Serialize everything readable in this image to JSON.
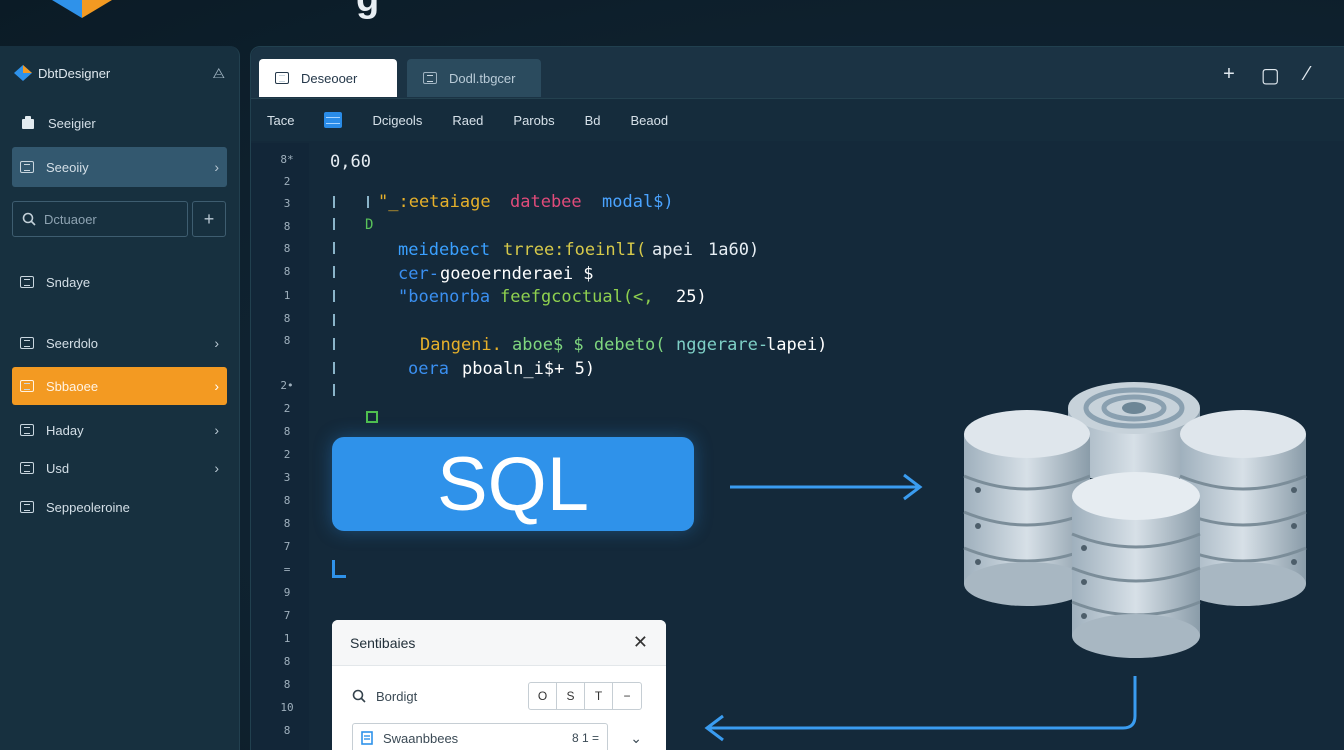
{
  "app": {
    "name": "DbtDesigner"
  },
  "sidebar": {
    "header_label": "DbtDesigner",
    "items": [
      {
        "label": "Seeigier"
      },
      {
        "label": "Seeoiiy"
      },
      {
        "label": "Sndaye"
      },
      {
        "label": "Seerdolo"
      },
      {
        "label": "Sbbaoee"
      },
      {
        "label": "Haday"
      },
      {
        "label": "Usd"
      },
      {
        "label": "Seppeoleroine"
      }
    ],
    "search_placeholder": "Dctuaoer"
  },
  "tabs": [
    {
      "label": "Deseooer"
    },
    {
      "label": "Dodl.tbgcer"
    }
  ],
  "toolbar": {
    "items": [
      "Tace",
      "Dcigeols",
      "Raed",
      "Parobs",
      "Bd",
      "Beaod"
    ]
  },
  "gutter": {
    "line_labels": [
      "8*",
      "2",
      "3",
      "8",
      "8",
      "8",
      "1",
      "8",
      "8",
      "2•",
      "2",
      "8",
      "2",
      "3",
      "8",
      "8",
      "7",
      "=",
      "9",
      "7",
      "1",
      "8",
      "8",
      "10",
      "8"
    ]
  },
  "code": {
    "header": "0,60",
    "lines": [
      {
        "text": "\"_:eetaiage",
        "color": "#e6b02a"
      },
      {
        "text": "datebee",
        "color": "#e04b7a"
      },
      {
        "text": "modal$)",
        "color": "#4aa3ff"
      },
      {
        "text": "D",
        "color": "#59c25a"
      },
      {
        "text": "meidebect",
        "color": "#3aa0ff"
      },
      {
        "text": "trree:foeinlI(",
        "color": "#d6c94a"
      },
      {
        "text": "apei",
        "color": "#e6edf3"
      },
      {
        "text": "1a60)",
        "color": "#e6edf3"
      },
      {
        "text": "cer-",
        "color": "#3a8ff0"
      },
      {
        "text": "goeoernderaei $",
        "color": "#ffffff"
      },
      {
        "text": "\"boenorba",
        "color": "#3a8ff0"
      },
      {
        "text": "feefgcoctual(<,",
        "color": "#8fd14f"
      },
      {
        "text": "25)",
        "color": "#ffffff"
      },
      {
        "text": "Dangeni.",
        "color": "#e6b02a"
      },
      {
        "text": "aboe$ $ debeto(",
        "color": "#7fd67f"
      },
      {
        "text": "nggerare-",
        "color": "#7ed0c6"
      },
      {
        "text": "lapei)",
        "color": "#ffffff"
      },
      {
        "text": "oera",
        "color": "#3a8ff0"
      },
      {
        "text": "pboaln_i$+ 5)",
        "color": "#ffffff"
      }
    ]
  },
  "sql_button": {
    "label": "SQL"
  },
  "dialog": {
    "title": "Sentibaies",
    "search_label": "Bordigt",
    "seg_buttons": [
      "O",
      "S",
      "T",
      "−"
    ],
    "row_label": "Swaanbbees",
    "row_value": "8 1 =",
    "row_chevron": "⌄"
  },
  "colors": {
    "accent_blue": "#2f92ea",
    "accent_orange": "#f39a22",
    "panel_bg": "#14293a",
    "sidebar_bg": "#17303f"
  },
  "icons": [
    "diamond-logo-icon",
    "pin-icon",
    "document-icon",
    "grid-icon",
    "search-icon",
    "plus-icon",
    "chevron-right-icon",
    "close-icon",
    "minimize-icon",
    "edit-icon",
    "database-stack-icon",
    "arrow-right-icon",
    "arrow-left-icon"
  ]
}
